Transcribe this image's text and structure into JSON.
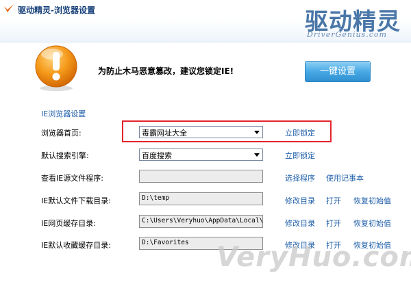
{
  "window": {
    "title": "驱动精灵-浏览器设置"
  },
  "brand": {
    "cn": "驱动精灵",
    "en": "DriverGenius.com"
  },
  "warning": {
    "text": "为防止木马恶意篡改，建议您锁定IE!"
  },
  "one_key_button": "一键设置",
  "section_title": "IE浏览器设置",
  "rows": {
    "homepage": {
      "label": "浏览器首页:",
      "value": "毒霸网址大全",
      "link": "立即锁定"
    },
    "search": {
      "label": "默认搜索引擎:",
      "value": "百度搜索",
      "link": "立即锁定"
    },
    "source": {
      "label": "查看IE源文件程序:",
      "value": "",
      "link1": "选择程序",
      "link2": "使用记事本"
    },
    "download": {
      "label": "IE默认文件下载目录:",
      "value": "D:\\temp",
      "link1": "修改目录",
      "link2": "打开",
      "link3": "恢复初始值"
    },
    "cache": {
      "label": "IE网页缓存目录:",
      "value": "C:\\Users\\Veryhuo\\AppData\\Local\\M",
      "link1": "修改目录",
      "link2": "打开",
      "link3": "恢复初始值"
    },
    "favorites": {
      "label": "IE默认收藏缓存目录:",
      "value": "D:\\Favorites",
      "link1": "修改目录",
      "link2": "打开",
      "link3": "恢复初始值"
    }
  },
  "watermark": "VeryHuo.com",
  "colors": {
    "link": "#1f5fa8",
    "highlight": "#e4232b",
    "button": "#49a9e5",
    "warning_icon": "#f59a1a"
  }
}
